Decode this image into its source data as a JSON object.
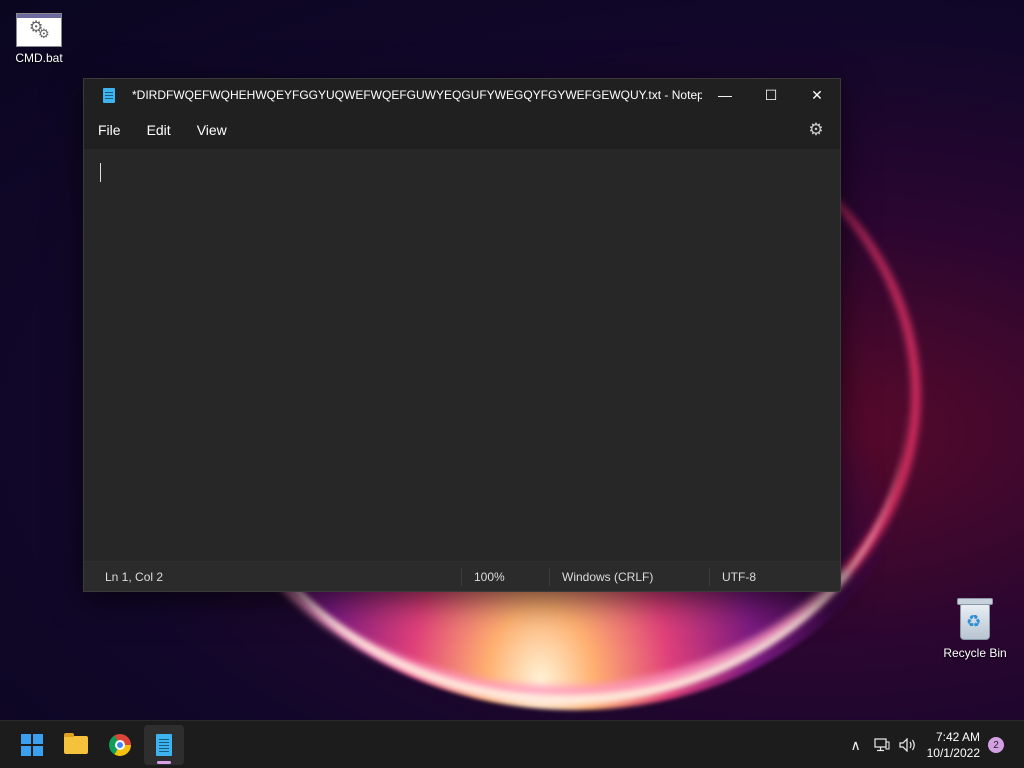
{
  "desktop": {
    "icons": [
      {
        "label": "CMD.bat",
        "icon": "batch-file-icon"
      },
      {
        "label": "Recycle Bin",
        "icon": "recycle-bin-icon"
      }
    ]
  },
  "window": {
    "title": "*DIRDFWQEFWQHEHWQEYFGGYUQWEFWQEFGUWYEQGUFYWEGQYFGYWEFGEWQUY.txt - Notepad",
    "controls": {
      "minimize": "—",
      "maximize": "☐",
      "close": "✕"
    },
    "menu": [
      "File",
      "Edit",
      "View"
    ],
    "settings_icon": "⚙",
    "editor_text": ""
  },
  "statusbar": {
    "position": "Ln 1, Col 2",
    "zoom": "100%",
    "line_ending": "Windows (CRLF)",
    "encoding": "UTF-8"
  },
  "taskbar": {
    "apps": [
      "start",
      "file-explorer",
      "chrome",
      "notepad"
    ],
    "tray": {
      "chevron": "∧",
      "time": "7:42 AM",
      "date": "10/1/2022",
      "notifications": "2"
    }
  }
}
